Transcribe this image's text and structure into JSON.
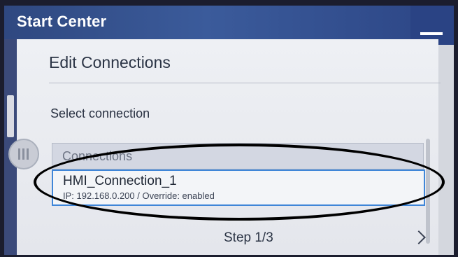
{
  "window": {
    "title": "Start Center"
  },
  "dialog": {
    "title": "Edit Connections",
    "section_label": "Select connection",
    "list": {
      "header": "Connections",
      "items": [
        {
          "name": "HMI_Connection_1",
          "detail": "IP: 192.168.0.200 / Override: enabled",
          "selected": true
        }
      ]
    },
    "footer": {
      "step": "Step 1/3"
    }
  },
  "icons": {
    "minimize": "minimize-icon",
    "handle": "drag-handle-icon",
    "next": "chevron-right-icon"
  },
  "colors": {
    "title_bar": "#3b5b9b",
    "selection_border": "#3f86d8",
    "annotation": "#000000"
  }
}
